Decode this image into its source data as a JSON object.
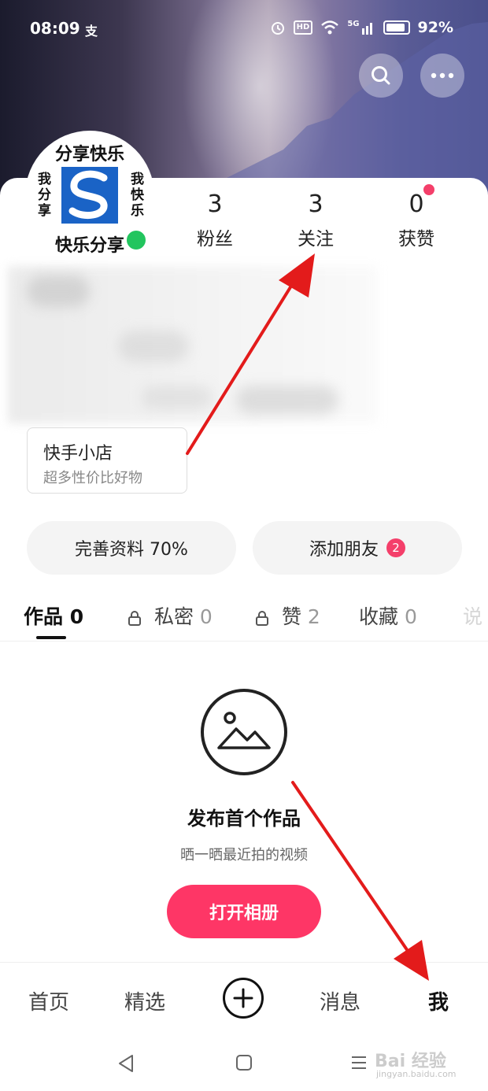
{
  "status_bar": {
    "time": "08:09",
    "app_indicator": "支",
    "hd_label": "HD",
    "network_label": "5G",
    "battery_percent": "92%"
  },
  "header": {
    "search_icon": "search-icon",
    "more_icon": "more-dots-icon"
  },
  "profile": {
    "avatar": {
      "top_text": "分享快乐",
      "left_text": "我分享",
      "right_text": "我快乐",
      "bottom_text": "快乐分享"
    },
    "stats": [
      {
        "value": "3",
        "label": "粉丝"
      },
      {
        "value": "3",
        "label": "关注"
      },
      {
        "value": "0",
        "label": "获赞"
      }
    ],
    "shop": {
      "title": "快手小店",
      "subtitle": "超多性价比好物"
    },
    "complete_profile_label": "完善资料 70%",
    "add_friends_label": "添加朋友",
    "add_friends_badge": "2"
  },
  "tabs": [
    {
      "label": "作品",
      "count": "0",
      "locked": false
    },
    {
      "label": "私密",
      "count": "0",
      "locked": true
    },
    {
      "label": "赞",
      "count": "2",
      "locked": true
    },
    {
      "label": "收藏",
      "count": "0",
      "locked": false
    },
    {
      "label": "说",
      "count": "",
      "locked": false
    }
  ],
  "empty_state": {
    "icon": "image-placeholder-icon",
    "title": "发布首个作品",
    "subtitle": "晒一晒最近拍的视频",
    "button_label": "打开相册"
  },
  "bottom_nav": {
    "items": [
      "首页",
      "精选",
      "消息",
      "我"
    ],
    "active": "我",
    "plus_icon": "plus-icon"
  },
  "system_nav": {
    "back_icon": "back-triangle-icon",
    "home_icon": "home-square-icon",
    "menu_icon": "menu-lines-icon"
  },
  "watermark": {
    "text": "Bai 经验",
    "url": "jingyan.baidu.com"
  },
  "colors": {
    "accent": "#fe3666",
    "badge": "#f43f6a",
    "online": "#22c55e",
    "annotation_arrow": "#e31b1b"
  }
}
